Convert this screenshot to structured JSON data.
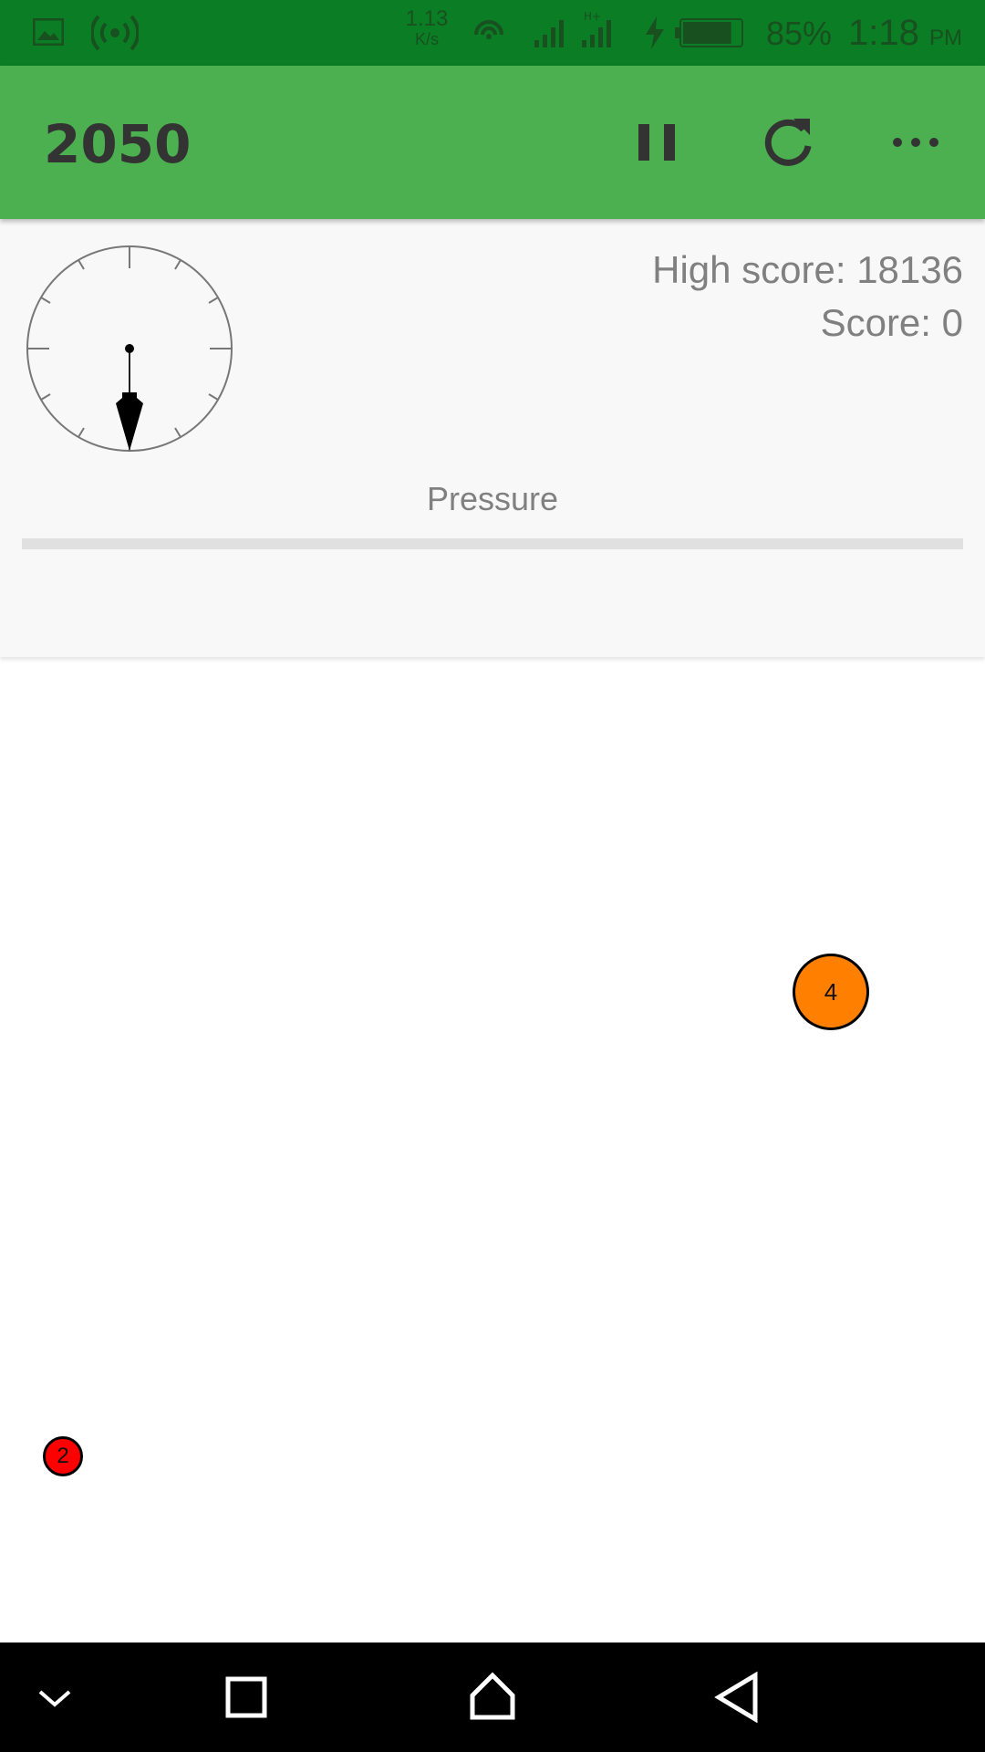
{
  "status_bar": {
    "net_speed_value": "1.13",
    "net_speed_unit": "K/s",
    "battery_percent": "85%",
    "time": "1:18",
    "ampm": "PM",
    "battery_level": 0.85,
    "icons": [
      "gallery-icon",
      "hotspot-icon",
      "cast-icon",
      "signal-icon",
      "signal-h-plus-icon",
      "charging-bolt-icon",
      "battery-icon"
    ]
  },
  "app_bar": {
    "title": "2050",
    "icons": [
      "pause-icon",
      "restart-icon",
      "more-icon"
    ]
  },
  "header": {
    "high_score": "High score: 18136",
    "score": "Score: 0",
    "pressure_label": "Pressure",
    "pressure_level": 0
  },
  "play_field": {
    "balls": [
      {
        "label": "4",
        "color": "#ff8000"
      },
      {
        "label": "2",
        "color": "#ff0000"
      }
    ]
  },
  "nav_bar": {
    "icons": [
      "hide-keyboard-chevron-icon",
      "recents-square-icon",
      "home-icon",
      "back-triangle-icon"
    ]
  },
  "colors": {
    "status_bar": "#0a7d25",
    "app_bar": "#4caf50",
    "header_bg": "#f8f8f8",
    "text_muted": "#808080"
  }
}
